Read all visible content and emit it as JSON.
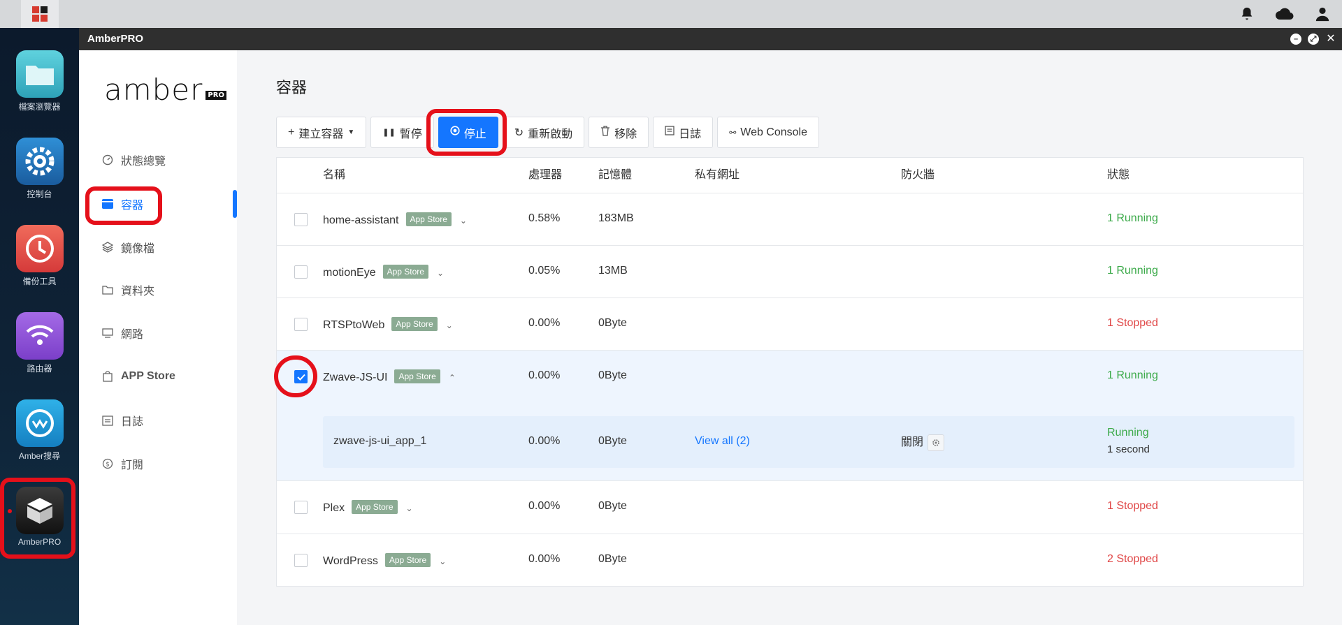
{
  "window_title": "AmberPRO",
  "logo": {
    "text": "amber",
    "badge": "PRO"
  },
  "dock": [
    {
      "label": "檔案瀏覽器",
      "icon": "folder-icon",
      "color": "#3fb5c9"
    },
    {
      "label": "控制台",
      "icon": "gear-icon",
      "color": "#1f6fb4"
    },
    {
      "label": "備份工具",
      "icon": "clock-icon",
      "color": "#e84b4b"
    },
    {
      "label": "路由器",
      "icon": "wifi-icon",
      "color": "#8c4fd6"
    },
    {
      "label": "Amber搜尋",
      "icon": "chat-icon",
      "color": "#1a9ad8"
    },
    {
      "label": "AmberPRO",
      "icon": "box-icon",
      "color": "#222222"
    }
  ],
  "nav": [
    {
      "label": "狀態總覽",
      "icon": "dashboard-icon"
    },
    {
      "label": "容器",
      "icon": "container-icon"
    },
    {
      "label": "鏡像檔",
      "icon": "layers-icon"
    },
    {
      "label": "資料夾",
      "icon": "folder-icon"
    },
    {
      "label": "網路",
      "icon": "monitor-icon"
    },
    {
      "label": "APP Store",
      "icon": "bag-icon"
    },
    {
      "label": "日誌",
      "icon": "calendar-icon"
    },
    {
      "label": "訂閱",
      "icon": "dollar-icon"
    }
  ],
  "page_title": "容器",
  "toolbar": {
    "create": "建立容器",
    "pause": "暫停",
    "stop": "停止",
    "restart": "重新啟動",
    "remove": "移除",
    "logs": "日誌",
    "console": "Web Console"
  },
  "columns": {
    "name": "名稱",
    "cpu": "處理器",
    "memory": "記憶體",
    "private_url": "私有網址",
    "firewall": "防火牆",
    "status": "狀態"
  },
  "tag_label": "App Store",
  "rows": [
    {
      "name": "home-assistant",
      "cpu": "0.58%",
      "mem": "183MB",
      "status": "1 Running"
    },
    {
      "name": "motionEye",
      "cpu": "0.05%",
      "mem": "13MB",
      "status": "1 Running"
    },
    {
      "name": "RTSPtoWeb",
      "cpu": "0.00%",
      "mem": "0Byte",
      "status": "1 Stopped"
    },
    {
      "name": "Zwave-JS-UI",
      "cpu": "0.00%",
      "mem": "0Byte",
      "status": "1 Running"
    },
    {
      "name": "Plex",
      "cpu": "0.00%",
      "mem": "0Byte",
      "status": "1 Stopped"
    },
    {
      "name": "WordPress",
      "cpu": "0.00%",
      "mem": "0Byte",
      "status": "2 Stopped"
    }
  ],
  "sub_row": {
    "name": "zwave-js-ui_app_1",
    "cpu": "0.00%",
    "mem": "0Byte",
    "url": "View all (2)",
    "firewall": "關閉",
    "status": "Running",
    "uptime": "1 second"
  },
  "colors": {
    "accent": "#1476ff",
    "running": "#3caa4a",
    "stopped": "#e04747",
    "highlight": "#e5101a"
  }
}
